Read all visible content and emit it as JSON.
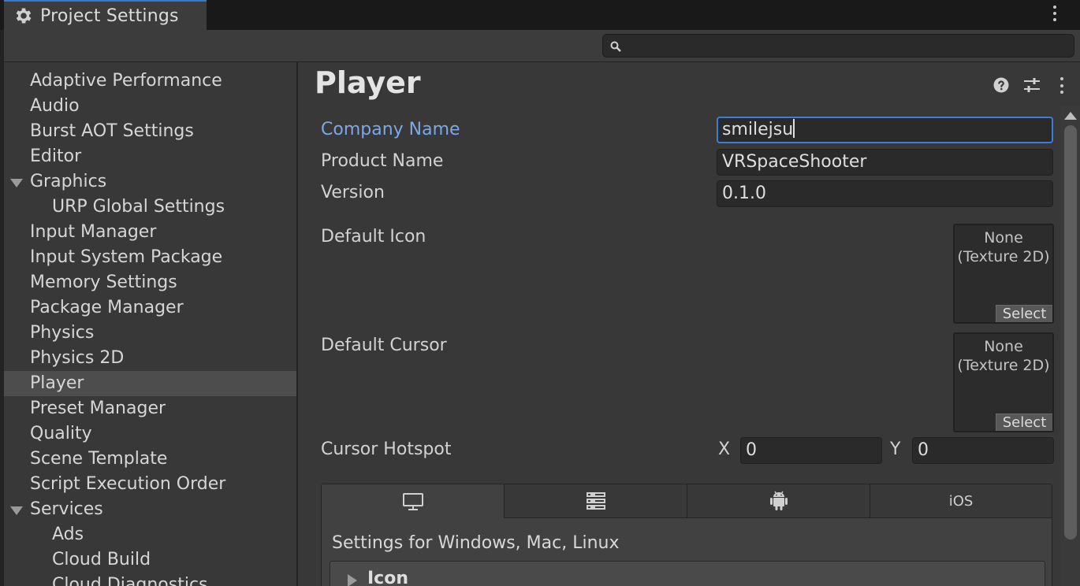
{
  "window": {
    "tab_title": "Project Settings"
  },
  "search": {
    "value": "",
    "placeholder": ""
  },
  "sidebar": {
    "items": [
      {
        "label": "Adaptive Performance",
        "indent": 0,
        "expanded": false
      },
      {
        "label": "Audio",
        "indent": 0,
        "expanded": false
      },
      {
        "label": "Burst AOT Settings",
        "indent": 0,
        "expanded": false
      },
      {
        "label": "Editor",
        "indent": 0,
        "expanded": false
      },
      {
        "label": "Graphics",
        "indent": 0,
        "expanded": true
      },
      {
        "label": "URP Global Settings",
        "indent": 1,
        "expanded": false
      },
      {
        "label": "Input Manager",
        "indent": 0,
        "expanded": false
      },
      {
        "label": "Input System Package",
        "indent": 0,
        "expanded": false
      },
      {
        "label": "Memory Settings",
        "indent": 0,
        "expanded": false
      },
      {
        "label": "Package Manager",
        "indent": 0,
        "expanded": false
      },
      {
        "label": "Physics",
        "indent": 0,
        "expanded": false
      },
      {
        "label": "Physics 2D",
        "indent": 0,
        "expanded": false
      },
      {
        "label": "Player",
        "indent": 0,
        "expanded": false,
        "selected": true
      },
      {
        "label": "Preset Manager",
        "indent": 0,
        "expanded": false
      },
      {
        "label": "Quality",
        "indent": 0,
        "expanded": false
      },
      {
        "label": "Scene Template",
        "indent": 0,
        "expanded": false
      },
      {
        "label": "Script Execution Order",
        "indent": 0,
        "expanded": false
      },
      {
        "label": "Services",
        "indent": 0,
        "expanded": true
      },
      {
        "label": "Ads",
        "indent": 1,
        "expanded": false
      },
      {
        "label": "Cloud Build",
        "indent": 1,
        "expanded": false
      },
      {
        "label": "Cloud Diagnostics",
        "indent": 1,
        "expanded": false
      }
    ]
  },
  "main": {
    "title": "Player",
    "fields": {
      "company_name_label": "Company Name",
      "company_name_value": "smilejsu",
      "product_name_label": "Product Name",
      "product_name_value": "VRSpaceShooter",
      "version_label": "Version",
      "version_value": "0.1.0",
      "default_icon_label": "Default Icon",
      "default_cursor_label": "Default Cursor",
      "object_none_line1": "None",
      "object_none_line2": "(Texture 2D)",
      "select_label": "Select",
      "cursor_hotspot_label": "Cursor Hotspot",
      "hotspot_x_label": "X",
      "hotspot_x_value": "0",
      "hotspot_y_label": "Y",
      "hotspot_y_value": "0"
    },
    "platform_tabs": [
      {
        "icon": "monitor-icon",
        "active": true
      },
      {
        "icon": "dedicated-server-icon",
        "active": false
      },
      {
        "icon": "android-icon",
        "active": false
      },
      {
        "label": "iOS",
        "active": false
      }
    ],
    "settings_for": "Settings for Windows, Mac, Linux",
    "section_icon": "Icon"
  },
  "colors": {
    "accent_blue": "#3d7dd3",
    "active_label": "#7da7e6",
    "panel_bg": "#383838",
    "field_bg": "#2a2a2a"
  }
}
